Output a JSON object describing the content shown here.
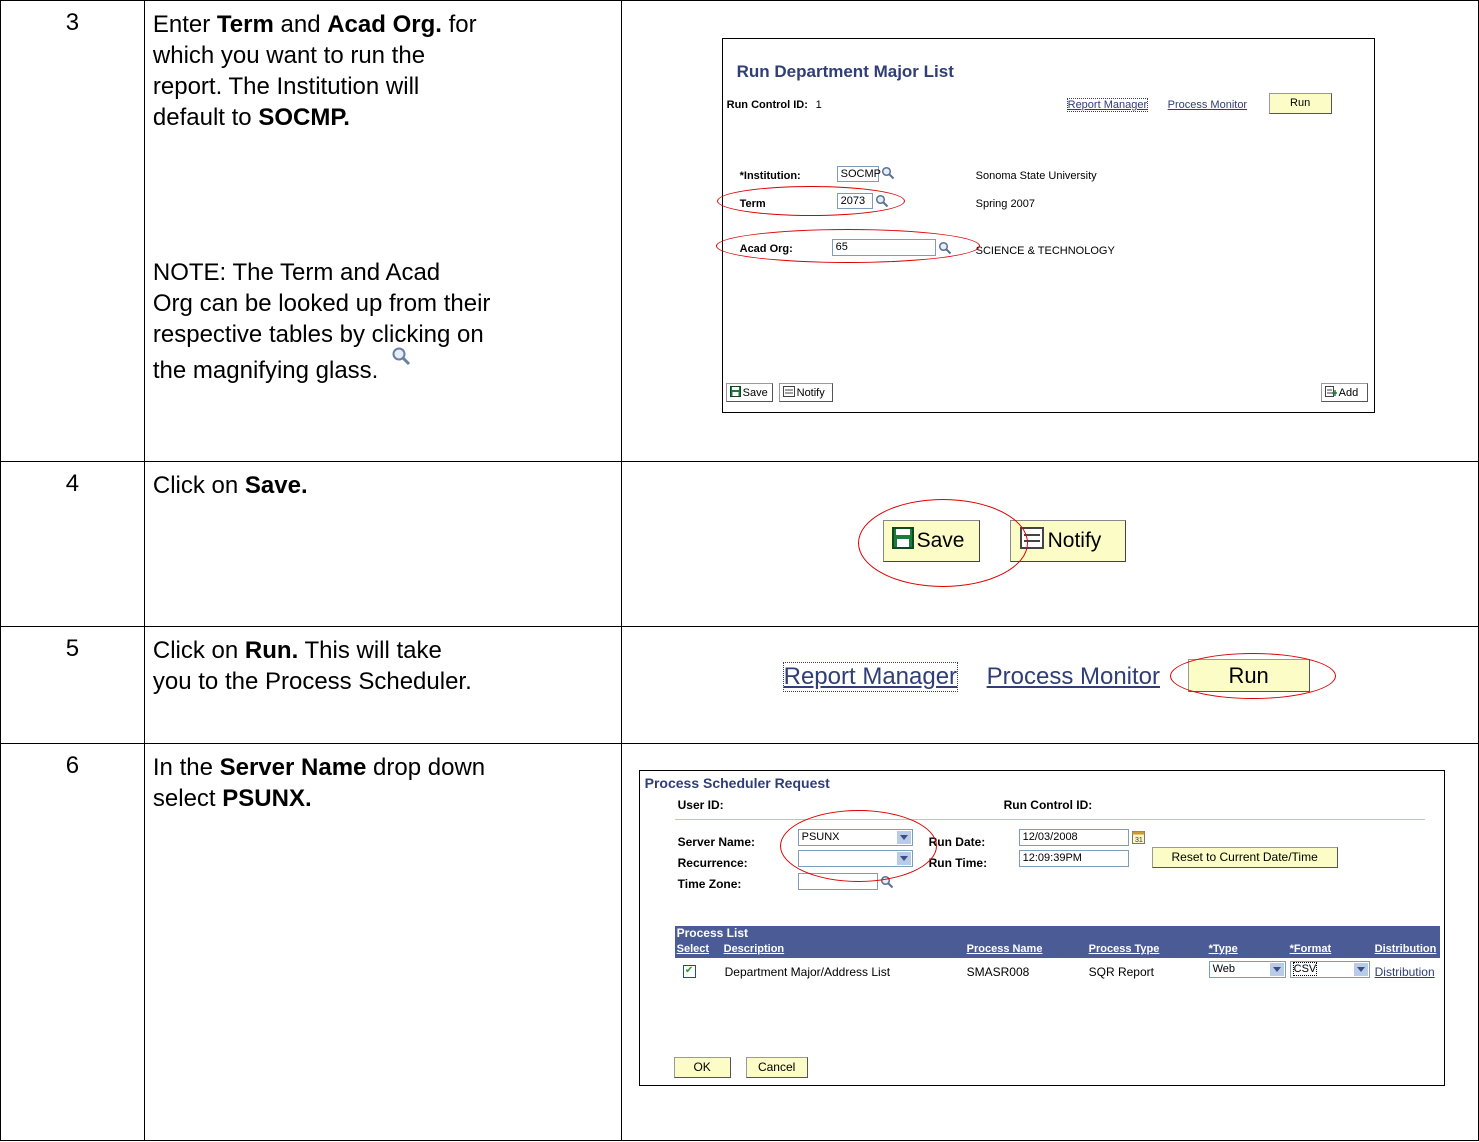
{
  "steps": [
    {
      "num": "3",
      "line1_a": "Enter ",
      "line1_b": "Term",
      "line1_c": " and ",
      "line1_d": "Acad Org.",
      "line1_e": " for",
      "line2": "which you want to run the",
      "line3": "report.  The Institution will",
      "line4_a": "default to ",
      "line4_b": "SOCMP.",
      "note1": "NOTE:  The Term and Acad",
      "note2": "Org can be looked up from their",
      "note3": "respective tables by clicking on",
      "note4": "the magnifying glass."
    },
    {
      "num": "4",
      "text_a": "Click on ",
      "text_b": "Save."
    },
    {
      "num": "5",
      "text_a": "Click on ",
      "text_b": "Run.",
      "text_c": "  This will take",
      "line2": "you to the Process Scheduler."
    },
    {
      "num": "6",
      "text_a": "In the ",
      "text_b": "Server Name",
      "text_c": " drop down",
      "line2_a": "select ",
      "line2_b": "PSUNX."
    }
  ],
  "run_dept_page": {
    "title": "Run Department Major List",
    "run_control_label": "Run Control ID:",
    "run_control_value": "1",
    "report_manager": "Report Manager",
    "process_monitor": "Process Monitor",
    "run": "Run",
    "institution_label": "*Institution:",
    "institution_value": "SOCMP",
    "institution_desc": "Sonoma State University",
    "term_label": "Term",
    "term_value": "2073",
    "term_desc": "Spring 2007",
    "acad_org_label": "Acad Org:",
    "acad_org_value": "65",
    "acad_org_desc": "SCIENCE & TECHNOLOGY",
    "save": "Save",
    "notify": "Notify",
    "add": "Add"
  },
  "save_notify": {
    "save": "Save",
    "notify": "Notify"
  },
  "run_bar": {
    "report_manager": "Report Manager",
    "process_monitor": "Process Monitor",
    "run": "Run"
  },
  "scheduler": {
    "title": "Process Scheduler Request",
    "user_id_label": "User ID:",
    "run_control_label": "Run Control ID:",
    "server_name_label": "Server Name:",
    "server_name_value": "PSUNX",
    "recurrence_label": "Recurrence:",
    "recurrence_value": "",
    "time_zone_label": "Time Zone:",
    "run_date_label": "Run Date:",
    "run_date_value": "12/03/2008",
    "run_time_label": "Run Time:",
    "run_time_value": "12:09:39PM",
    "reset_button": "Reset to Current Date/Time",
    "process_list": "Process List",
    "columns": [
      "Select",
      "Description",
      "Process Name",
      "Process Type",
      "*Type",
      "*Format",
      "Distribution"
    ],
    "row": {
      "description": "Department Major/Address List",
      "process_name": "SMASR008",
      "process_type": "SQR Report",
      "type": "Web",
      "format": "CSV",
      "distribution": "Distribution"
    },
    "ok": "OK",
    "cancel": "Cancel"
  },
  "colors": {
    "ps_blue": "#2f3e77",
    "grid_header": "#4a5b95",
    "button_yellow": "#fbfcc6",
    "annotation_red": "#dd0000"
  }
}
